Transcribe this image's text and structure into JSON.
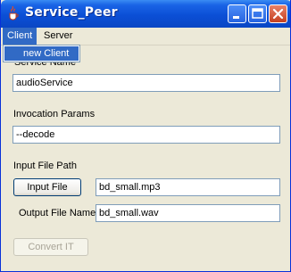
{
  "window": {
    "title": "Service_Peer",
    "icon": "java-cup-icon",
    "controls": [
      "minimize-icon",
      "maximize-icon",
      "close-icon"
    ],
    "colors": {
      "titlebar": "#0a4fd6",
      "menu_highlight": "#316ac5",
      "close": "#c4401f"
    }
  },
  "menubar": {
    "client": "Client",
    "server": "Server"
  },
  "client_menu": {
    "new_client": "new Client"
  },
  "form": {
    "service_name_label": "Service Name",
    "service_name_value": "audioService",
    "invocation_params_label": "Invocation Params",
    "invocation_params_value": "--decode",
    "input_file_path_label": "Input File Path",
    "input_file_button": "Input File",
    "input_file_value": "bd_small.mp3",
    "output_file_name_label": "Output File Name",
    "output_file_name_value": "bd_small.wav",
    "convert_button": "Convert IT"
  }
}
